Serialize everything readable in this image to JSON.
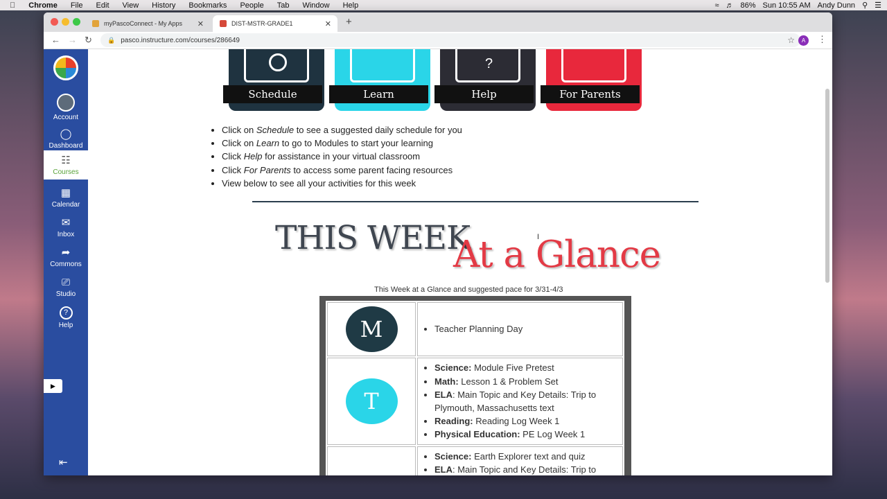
{
  "menubar": {
    "items": [
      "Chrome",
      "File",
      "Edit",
      "View",
      "History",
      "Bookmarks",
      "People",
      "Tab",
      "Window",
      "Help"
    ],
    "battery": "86%",
    "clock": "Sun 10:55 AM",
    "user": "Andy Dunn"
  },
  "tabs": [
    {
      "title": "myPascoConnect - My Apps"
    },
    {
      "title": "DIST-MSTR-GRADE1"
    }
  ],
  "toolbar": {
    "url": "pasco.instructure.com/courses/286649",
    "profile_initial": "A"
  },
  "sidebar": {
    "items": [
      {
        "label": "Account",
        "icon": "account-avatar-icon"
      },
      {
        "label": "Dashboard",
        "icon": "dashboard-icon"
      },
      {
        "label": "Courses",
        "icon": "courses-icon"
      },
      {
        "label": "Calendar",
        "icon": "calendar-icon"
      },
      {
        "label": "Inbox",
        "icon": "inbox-icon"
      },
      {
        "label": "Commons",
        "icon": "commons-icon"
      },
      {
        "label": "Studio",
        "icon": "studio-icon"
      },
      {
        "label": "Help",
        "icon": "help-icon"
      }
    ]
  },
  "cards": [
    {
      "label": "Schedule",
      "color": "#1f3340"
    },
    {
      "label": "Learn",
      "color": "#2ad5e8"
    },
    {
      "label": "Help",
      "color": "#2c2c34"
    },
    {
      "label": "For Parents",
      "color": "#e8283c"
    }
  ],
  "bullets": [
    {
      "pre": "Click on ",
      "em": "Schedule",
      "post": " to see a suggested daily schedule for you"
    },
    {
      "pre": "Click on ",
      "em": "Learn",
      "post": " to go to Modules to start your learning"
    },
    {
      "pre": "Click ",
      "em": "Help",
      "post": " for assistance in your virtual classroom"
    },
    {
      "pre": "Click ",
      "em": "For Parents",
      "post": " to access some parent facing resources"
    },
    {
      "pre": "View below to see all your activities for this week",
      "em": "",
      "post": ""
    }
  ],
  "banner": {
    "this_week": "THIS WEEK",
    "at_a_glance": "At a Glance"
  },
  "caption": "This Week at a Glance and suggested pace for 3/31-4/3",
  "schedule": [
    {
      "letter": "M",
      "color": "#1f3a45",
      "items": [
        {
          "subject": "",
          "text": "Teacher Planning Day"
        }
      ]
    },
    {
      "letter": "T",
      "color": "#2ad5e8",
      "items": [
        {
          "subject": "Science:",
          "text": " Module Five Pretest"
        },
        {
          "subject": "Math:",
          "text": " Lesson 1 & Problem Set"
        },
        {
          "subject": "ELA",
          "text": ": Main Topic and Key Details: Trip to Plymouth, Massachusetts text"
        },
        {
          "subject": "Reading:",
          "text": " Reading Log Week 1"
        },
        {
          "subject": "Physical Education:",
          "text": " PE Log Week 1"
        }
      ]
    },
    {
      "letter": "",
      "color": "#ffffff",
      "items": [
        {
          "subject": "Science:",
          "text": " Earth Explorer text and quiz"
        },
        {
          "subject": "ELA",
          "text": ": Main Topic and Key Details: Trip to"
        }
      ]
    }
  ]
}
